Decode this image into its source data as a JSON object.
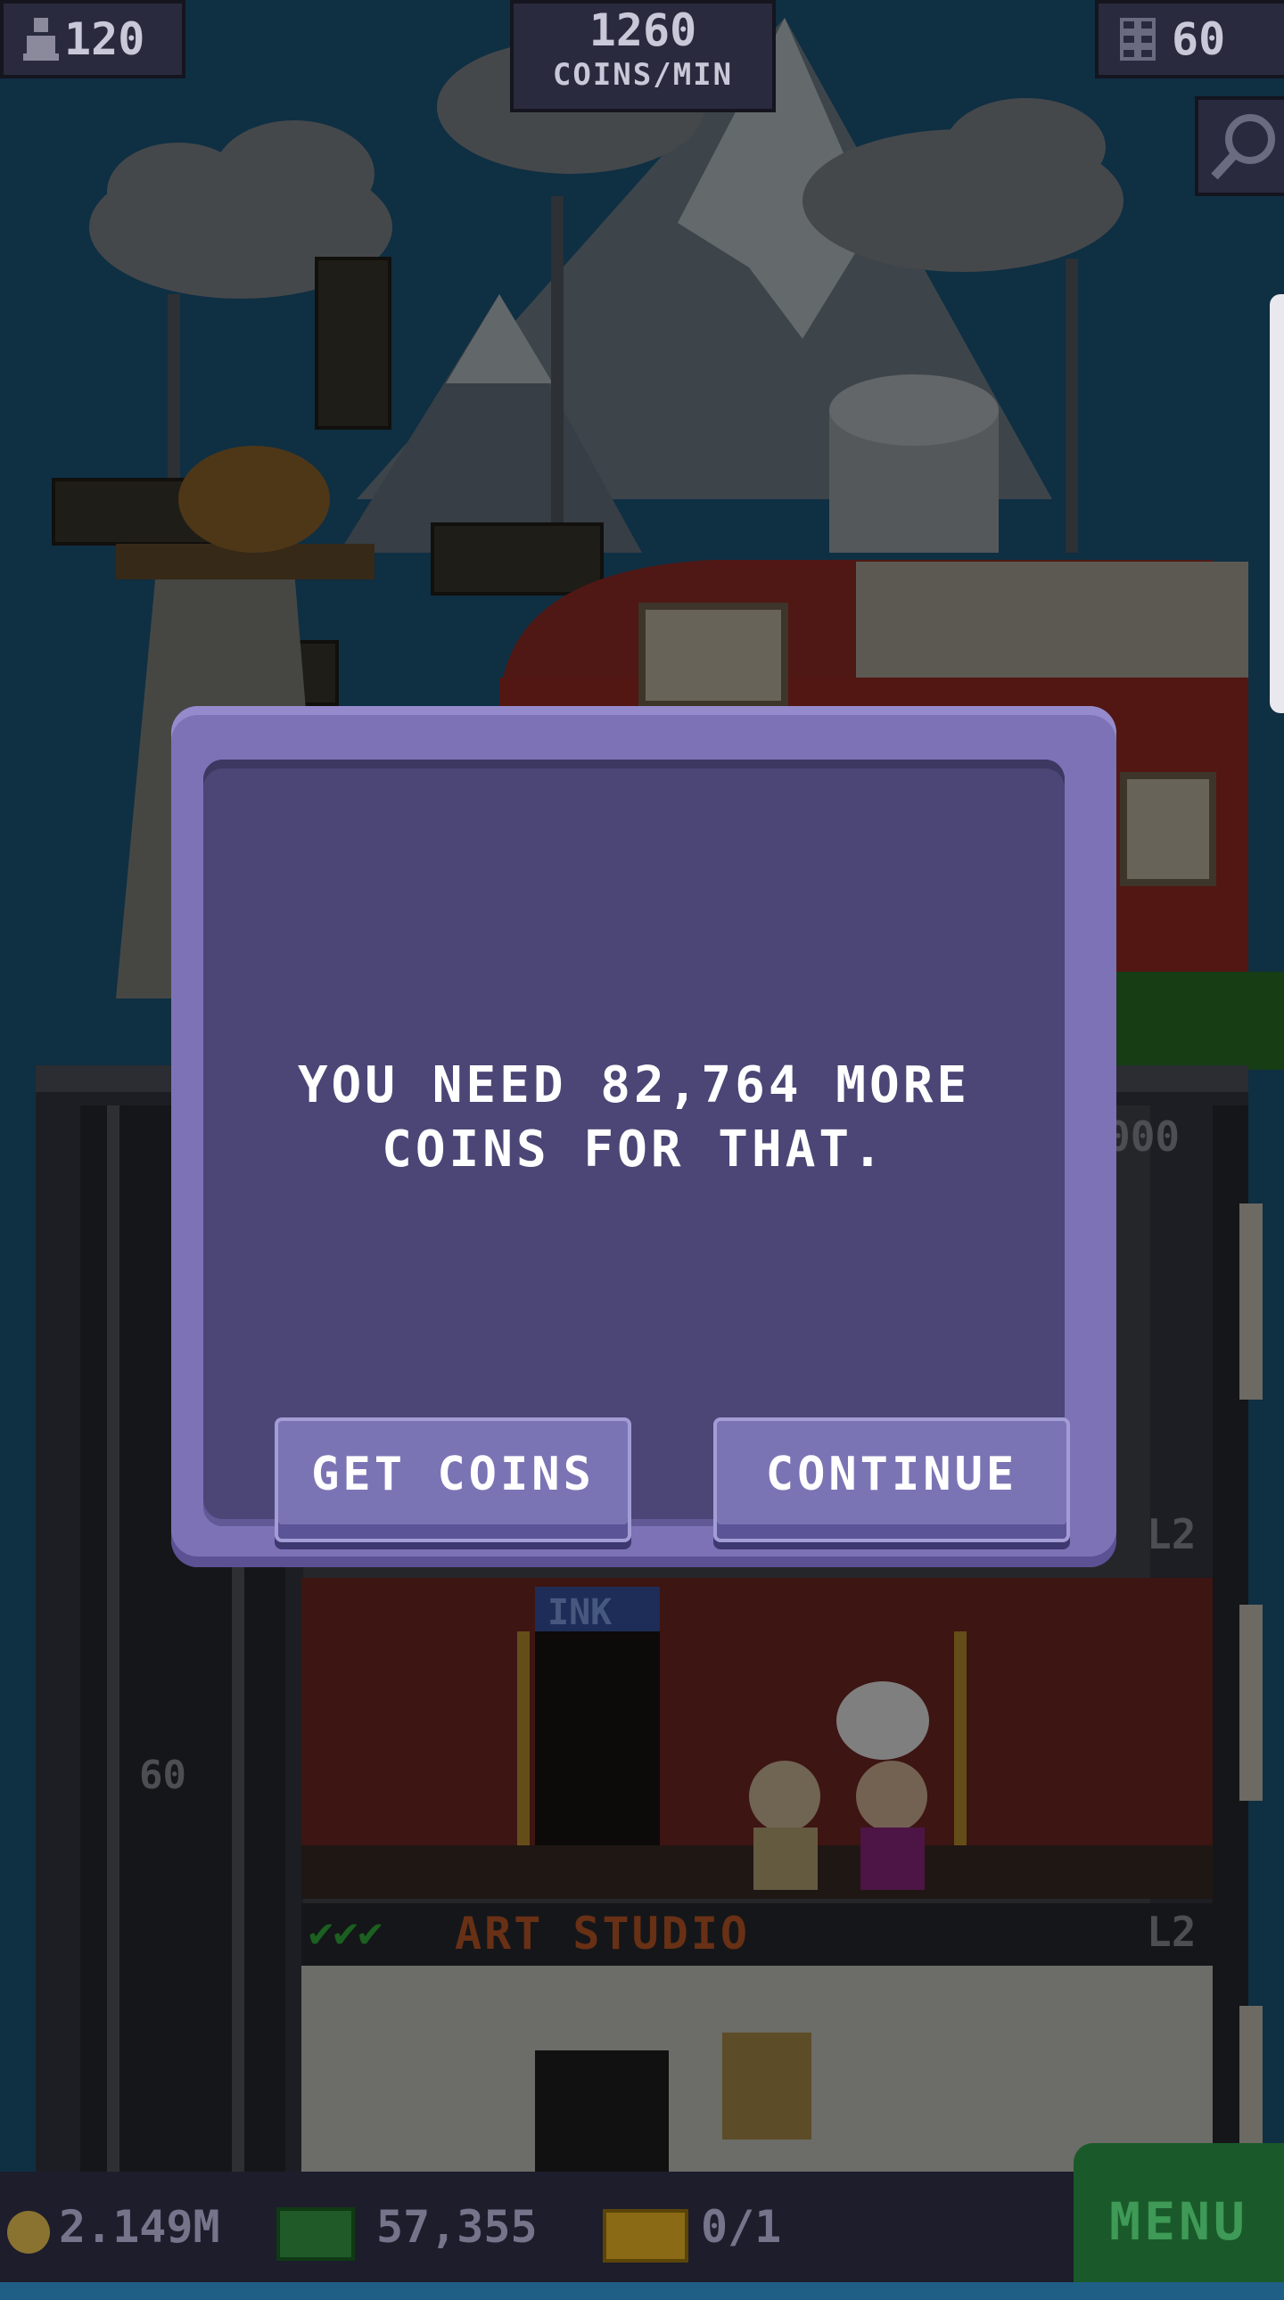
{
  "hud": {
    "population": "120",
    "coins_rate": "1260",
    "coins_rate_unit": "COINS/MIN",
    "floors": "60"
  },
  "tower": {
    "room_name": "ART STUDIO",
    "room_level": "L2",
    "other_room_level": "L2",
    "floor_number": "60",
    "sign_text": "INK",
    "partial_label": "000"
  },
  "dialog": {
    "message_line1": "YOU NEED 82,764 MORE",
    "message_line2": "COINS FOR THAT.",
    "get_coins_label": "GET COINS",
    "continue_label": "CONTINUE"
  },
  "bottombar": {
    "coins": "2.149M",
    "bux": "57,355",
    "tickets": "0/1",
    "menu_label": "MENU"
  },
  "colors": {
    "sky": "#1f5f86",
    "dialog_frame": "#7d72b6",
    "dialog_body": "#4b4676",
    "button": "#7b74b4",
    "menu_green": "#1a5a2a"
  },
  "icons": [
    "person-icon",
    "building-icon",
    "search-icon",
    "coin-icon",
    "bux-icon",
    "ticket-icon",
    "checkmark-icon"
  ]
}
